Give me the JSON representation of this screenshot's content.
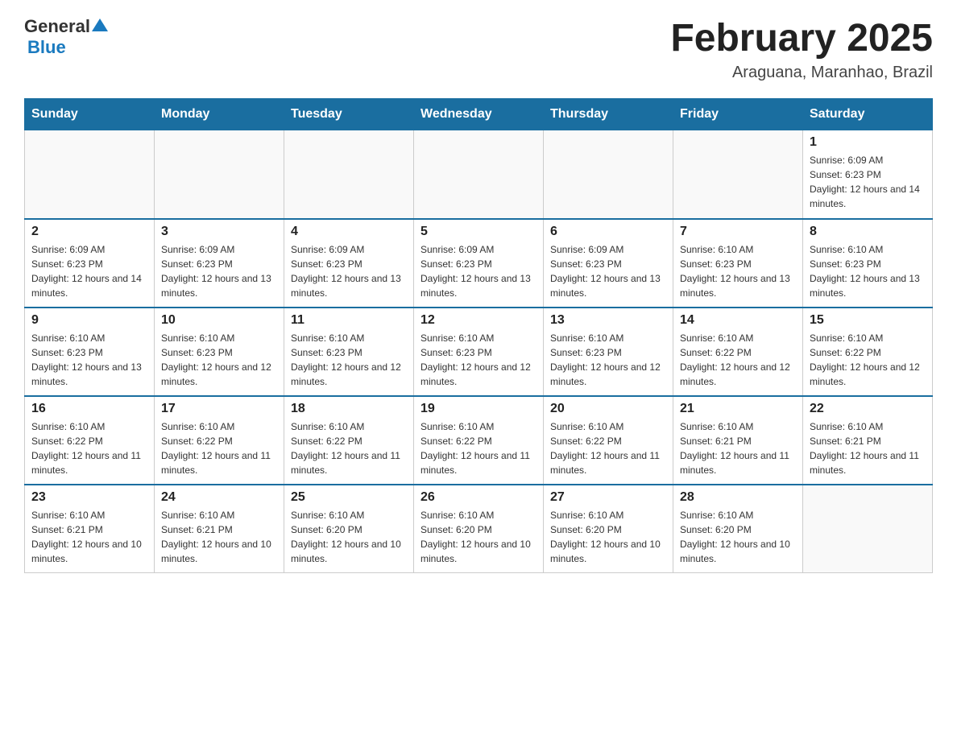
{
  "header": {
    "logo_general": "General",
    "logo_blue": "Blue",
    "month": "February 2025",
    "location": "Araguana, Maranhao, Brazil"
  },
  "weekdays": [
    "Sunday",
    "Monday",
    "Tuesday",
    "Wednesday",
    "Thursday",
    "Friday",
    "Saturday"
  ],
  "weeks": [
    {
      "days": [
        {
          "num": "",
          "info": ""
        },
        {
          "num": "",
          "info": ""
        },
        {
          "num": "",
          "info": ""
        },
        {
          "num": "",
          "info": ""
        },
        {
          "num": "",
          "info": ""
        },
        {
          "num": "",
          "info": ""
        },
        {
          "num": "1",
          "info": "Sunrise: 6:09 AM\nSunset: 6:23 PM\nDaylight: 12 hours and 14 minutes."
        }
      ]
    },
    {
      "days": [
        {
          "num": "2",
          "info": "Sunrise: 6:09 AM\nSunset: 6:23 PM\nDaylight: 12 hours and 14 minutes."
        },
        {
          "num": "3",
          "info": "Sunrise: 6:09 AM\nSunset: 6:23 PM\nDaylight: 12 hours and 13 minutes."
        },
        {
          "num": "4",
          "info": "Sunrise: 6:09 AM\nSunset: 6:23 PM\nDaylight: 12 hours and 13 minutes."
        },
        {
          "num": "5",
          "info": "Sunrise: 6:09 AM\nSunset: 6:23 PM\nDaylight: 12 hours and 13 minutes."
        },
        {
          "num": "6",
          "info": "Sunrise: 6:09 AM\nSunset: 6:23 PM\nDaylight: 12 hours and 13 minutes."
        },
        {
          "num": "7",
          "info": "Sunrise: 6:10 AM\nSunset: 6:23 PM\nDaylight: 12 hours and 13 minutes."
        },
        {
          "num": "8",
          "info": "Sunrise: 6:10 AM\nSunset: 6:23 PM\nDaylight: 12 hours and 13 minutes."
        }
      ]
    },
    {
      "days": [
        {
          "num": "9",
          "info": "Sunrise: 6:10 AM\nSunset: 6:23 PM\nDaylight: 12 hours and 13 minutes."
        },
        {
          "num": "10",
          "info": "Sunrise: 6:10 AM\nSunset: 6:23 PM\nDaylight: 12 hours and 12 minutes."
        },
        {
          "num": "11",
          "info": "Sunrise: 6:10 AM\nSunset: 6:23 PM\nDaylight: 12 hours and 12 minutes."
        },
        {
          "num": "12",
          "info": "Sunrise: 6:10 AM\nSunset: 6:23 PM\nDaylight: 12 hours and 12 minutes."
        },
        {
          "num": "13",
          "info": "Sunrise: 6:10 AM\nSunset: 6:23 PM\nDaylight: 12 hours and 12 minutes."
        },
        {
          "num": "14",
          "info": "Sunrise: 6:10 AM\nSunset: 6:22 PM\nDaylight: 12 hours and 12 minutes."
        },
        {
          "num": "15",
          "info": "Sunrise: 6:10 AM\nSunset: 6:22 PM\nDaylight: 12 hours and 12 minutes."
        }
      ]
    },
    {
      "days": [
        {
          "num": "16",
          "info": "Sunrise: 6:10 AM\nSunset: 6:22 PM\nDaylight: 12 hours and 11 minutes."
        },
        {
          "num": "17",
          "info": "Sunrise: 6:10 AM\nSunset: 6:22 PM\nDaylight: 12 hours and 11 minutes."
        },
        {
          "num": "18",
          "info": "Sunrise: 6:10 AM\nSunset: 6:22 PM\nDaylight: 12 hours and 11 minutes."
        },
        {
          "num": "19",
          "info": "Sunrise: 6:10 AM\nSunset: 6:22 PM\nDaylight: 12 hours and 11 minutes."
        },
        {
          "num": "20",
          "info": "Sunrise: 6:10 AM\nSunset: 6:22 PM\nDaylight: 12 hours and 11 minutes."
        },
        {
          "num": "21",
          "info": "Sunrise: 6:10 AM\nSunset: 6:21 PM\nDaylight: 12 hours and 11 minutes."
        },
        {
          "num": "22",
          "info": "Sunrise: 6:10 AM\nSunset: 6:21 PM\nDaylight: 12 hours and 11 minutes."
        }
      ]
    },
    {
      "days": [
        {
          "num": "23",
          "info": "Sunrise: 6:10 AM\nSunset: 6:21 PM\nDaylight: 12 hours and 10 minutes."
        },
        {
          "num": "24",
          "info": "Sunrise: 6:10 AM\nSunset: 6:21 PM\nDaylight: 12 hours and 10 minutes."
        },
        {
          "num": "25",
          "info": "Sunrise: 6:10 AM\nSunset: 6:20 PM\nDaylight: 12 hours and 10 minutes."
        },
        {
          "num": "26",
          "info": "Sunrise: 6:10 AM\nSunset: 6:20 PM\nDaylight: 12 hours and 10 minutes."
        },
        {
          "num": "27",
          "info": "Sunrise: 6:10 AM\nSunset: 6:20 PM\nDaylight: 12 hours and 10 minutes."
        },
        {
          "num": "28",
          "info": "Sunrise: 6:10 AM\nSunset: 6:20 PM\nDaylight: 12 hours and 10 minutes."
        },
        {
          "num": "",
          "info": ""
        }
      ]
    }
  ]
}
